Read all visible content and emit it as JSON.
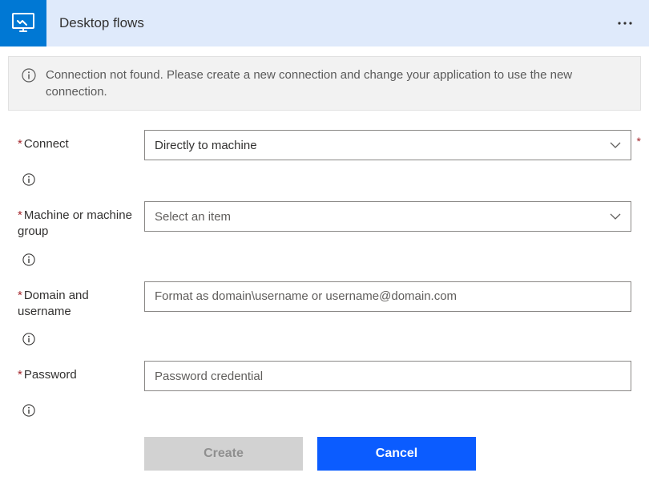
{
  "header": {
    "title": "Desktop flows"
  },
  "alert": {
    "text": "Connection not found. Please create a new connection and change your application to use the new connection."
  },
  "form": {
    "connect": {
      "label": "Connect",
      "value": "Directly to machine"
    },
    "machine": {
      "label": "Machine or machine group",
      "placeholder": "Select an item"
    },
    "domain_user": {
      "label": "Domain and username",
      "placeholder": "Format as domain\\username or username@domain.com"
    },
    "password": {
      "label": "Password",
      "placeholder": "Password credential"
    }
  },
  "buttons": {
    "create": "Create",
    "cancel": "Cancel"
  }
}
